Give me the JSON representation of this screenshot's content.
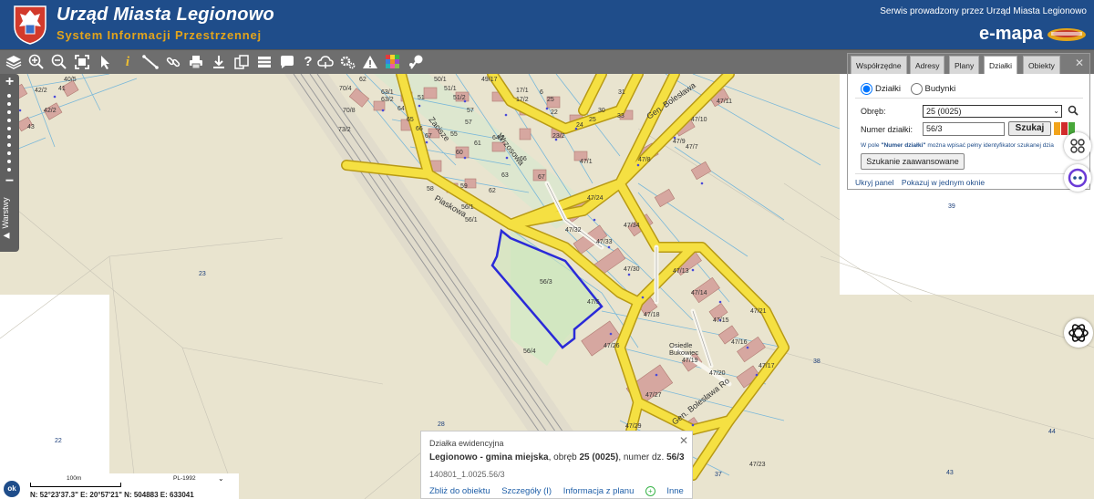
{
  "header": {
    "title": "Urząd Miasta Legionowo",
    "subtitle": "System Informacji Przestrzennej",
    "service": "Serwis prowadzony przez Urząd Miasta Legionowo",
    "emapa": "e-mapa"
  },
  "toolbar": {
    "tools": [
      "layers-icon",
      "zoom-in-icon",
      "zoom-out-icon",
      "zoom-extent-icon",
      "pointer-icon",
      "info-icon",
      "measure-icon",
      "link-icon",
      "print-icon",
      "download-icon",
      "copy-icon",
      "table-icon",
      "comment-icon",
      "help-icon",
      "cloud-icon",
      "settings-icon",
      "warning-icon",
      "color-grid-icon",
      "pin-icon"
    ]
  },
  "zoom": {
    "plus": "+",
    "minus": "−",
    "layers_label": "▶ Warstwy"
  },
  "panel": {
    "tabs": [
      "Współrzędne",
      "Adresy",
      "Plany",
      "Działki",
      "Obiekty"
    ],
    "active_tab": "Działki",
    "radio": {
      "dzialki": "Działki",
      "budynki": "Budynki"
    },
    "obreb_label": "Obręb:",
    "obreb_value": "25 (0025)",
    "numer_label": "Numer działki:",
    "numer_value": "56/3",
    "search_button": "Szukaj",
    "hint_prefix": "W pole ",
    "hint_bold": "\"Numer działki\"",
    "hint_suffix": " można wpisać pełny identyfikator szukanej dzia",
    "advanced_button": "Szukanie zaawansowane",
    "link_hide": "Ukryj panel",
    "link_window": "Pokazuj w jednym oknie"
  },
  "popup": {
    "title": "Działka ewidencyjna",
    "main_bold": "Legionowo - gmina miejska",
    "main_mid": ", obręb ",
    "obreb_bold": "25 (0025)",
    "main_mid2": ", numer dz. ",
    "numer_bold": "56/3",
    "identifier": "140801_1.0025.56/3",
    "links": [
      "Zbliż do obiektu",
      "Szczegóły (I)",
      "Informacja z planu",
      "Inne"
    ]
  },
  "scale": {
    "ok": "ok",
    "label": "100m",
    "crs": "PL-1992",
    "coords": "N: 52°23'37.3\"  E: 20°57'21\"    N: 504883    E: 633041"
  },
  "map": {
    "selected_plot": "56/3",
    "street_labels": [
      "Zacisze",
      "Wrzosowa",
      "Piaskowa",
      "Gen. Bolesława",
      "Gen. Bolesława Ro",
      "Osiedle Bukowiec"
    ],
    "area_labels": [
      "23",
      "22",
      "28",
      "37",
      "38",
      "39",
      "43",
      "44",
      "47/23",
      "56/4",
      "56/1",
      "47/5"
    ]
  },
  "colors": {
    "header": "#1f4d8a",
    "accent": "#e3a41b",
    "road": "#f5e042",
    "selection": "#2a2ad8",
    "buildings": "#d6a7a0",
    "parcel_lines": "#7ab8d9"
  }
}
